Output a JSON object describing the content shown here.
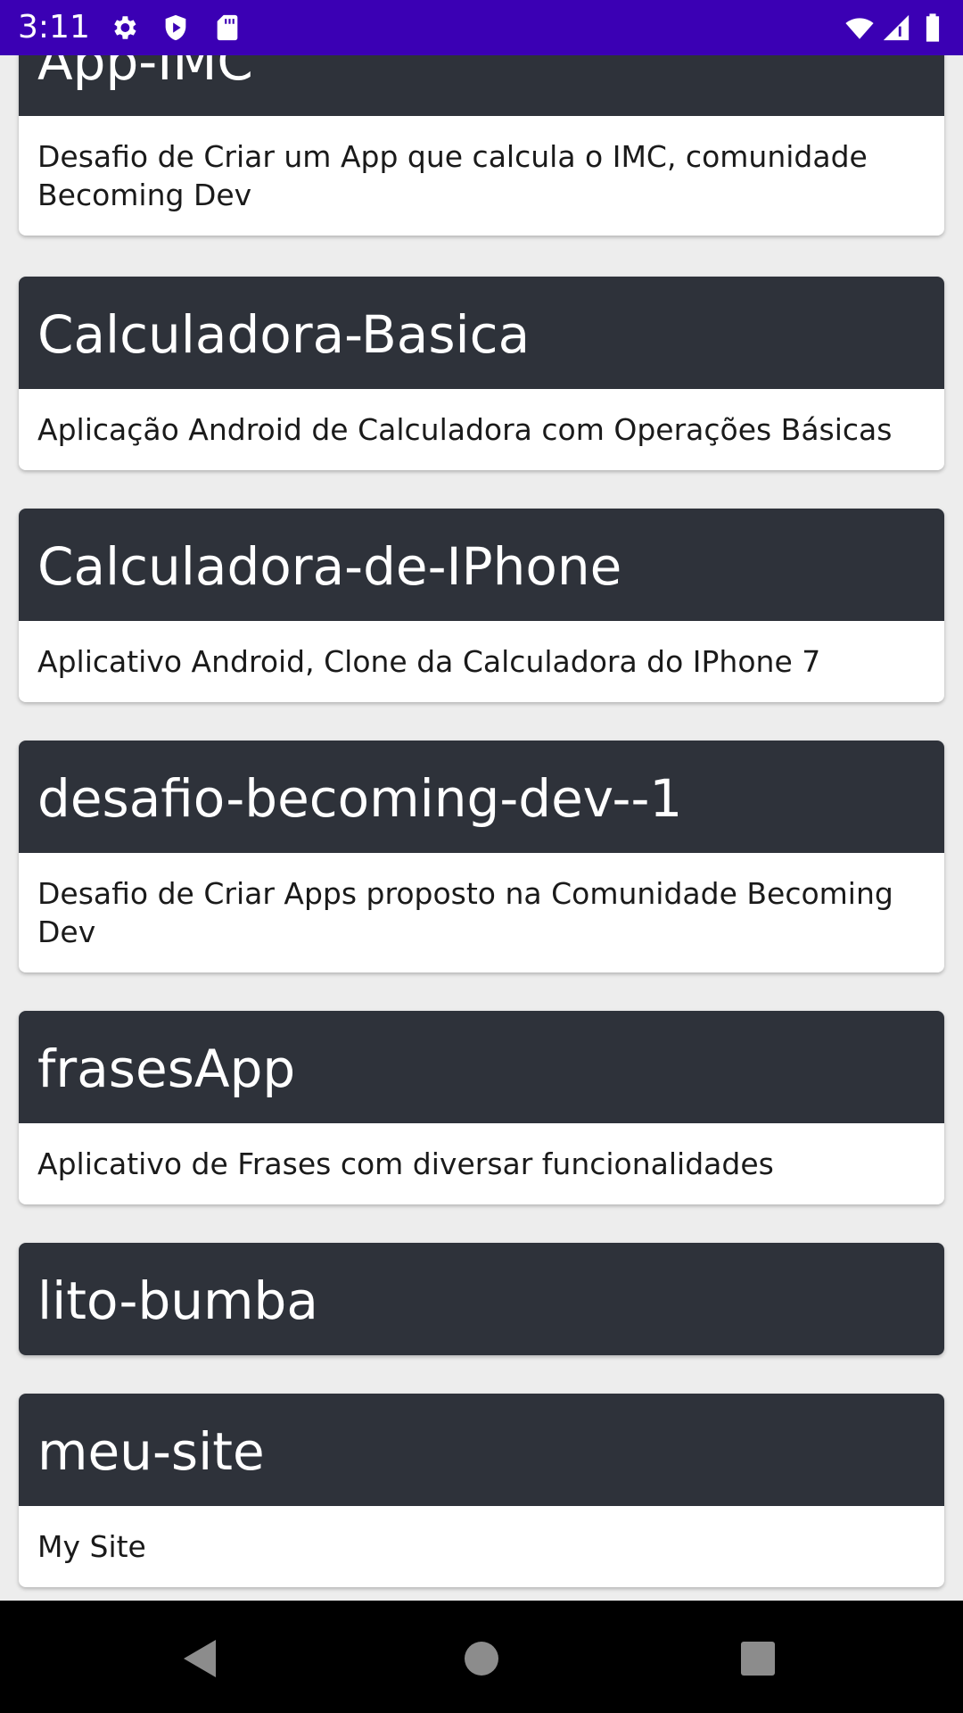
{
  "status_bar": {
    "time": "3:11",
    "left_icons": [
      "settings-icon",
      "shield-icon",
      "sd-card-icon"
    ],
    "right_icons": [
      "wifi-icon",
      "signal-icon",
      "battery-icon"
    ],
    "background_color": "#3b00b4"
  },
  "repos": [
    {
      "name": "App-IMC",
      "description": "Desafio de Criar um App que calcula o IMC, comunidade Becoming Dev"
    },
    {
      "name": "Calculadora-Basica",
      "description": "Aplicação Android de Calculadora com Operações Básicas"
    },
    {
      "name": "Calculadora-de-IPhone",
      "description": "Aplicativo Android, Clone da Calculadora do IPhone 7"
    },
    {
      "name": "desafio-becoming-dev--1",
      "description": "Desafio de Criar Apps proposto na Comunidade Becoming Dev"
    },
    {
      "name": "frasesApp",
      "description": "Aplicativo de Frases com diversar funcionalidades"
    },
    {
      "name": "lito-bumba",
      "description": ""
    },
    {
      "name": "meu-site",
      "description": "My Site"
    }
  ],
  "colors": {
    "card_header": "#2e323a",
    "card_body": "#ffffff",
    "list_background": "#ededed"
  },
  "nav_bar": {
    "buttons": [
      "back-icon",
      "home-icon",
      "recents-icon"
    ]
  }
}
